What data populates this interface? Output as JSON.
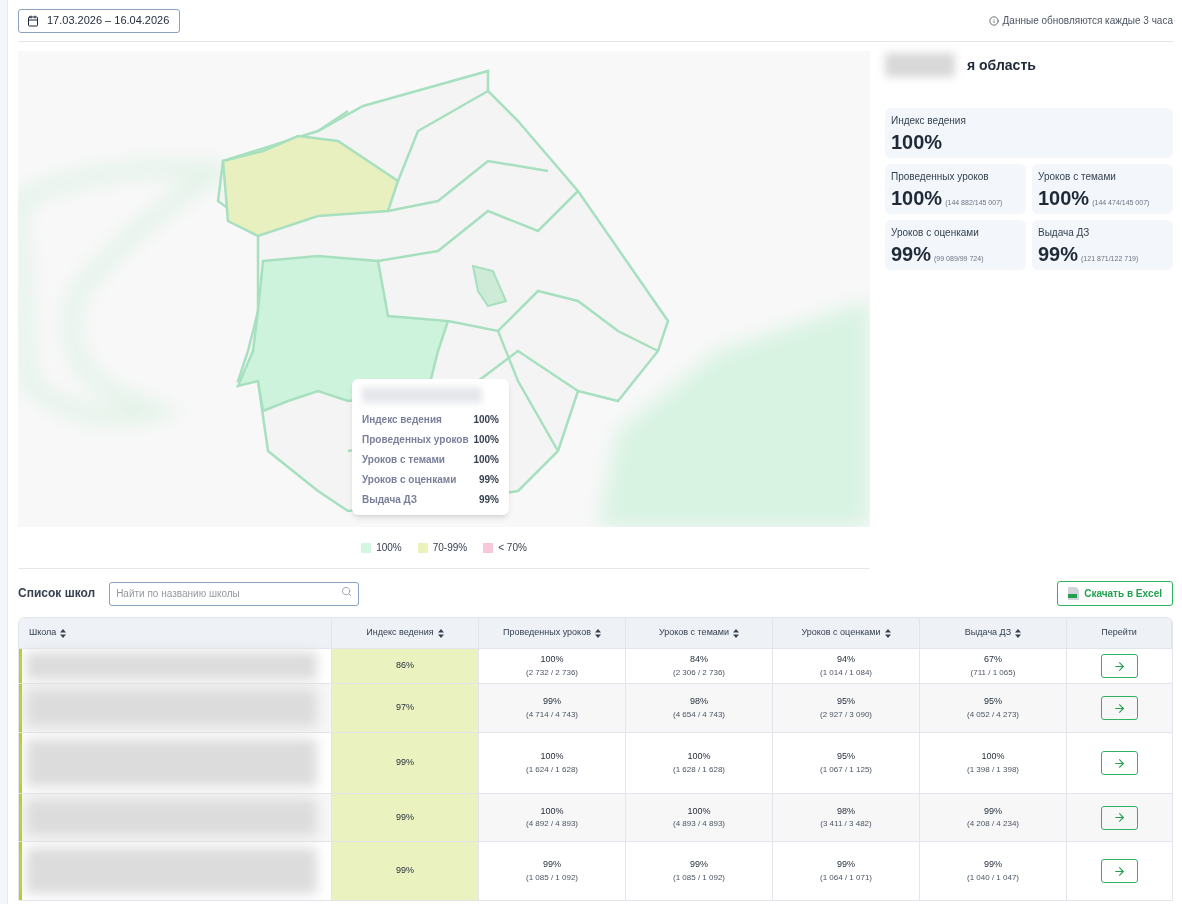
{
  "date_range": "17.03.2026 – 16.04.2026",
  "update_note": "Данные обновляются каждые 3 часа",
  "region": {
    "title": "я область",
    "metrics": [
      {
        "label": "Индекс ведения",
        "value": "100%"
      },
      {
        "label": "Проведенных уроков",
        "value": "100%",
        "detail": "(144 882/145 007)"
      },
      {
        "label": "Уроков с темами",
        "value": "100%",
        "detail": "(144 474/145 007)"
      },
      {
        "label": "Уроков с оценками",
        "value": "99%",
        "detail": "(99 089/99 724)"
      },
      {
        "label": "Выдача ДЗ",
        "value": "99%",
        "detail": "(121 871/122 719)"
      }
    ]
  },
  "map": {
    "tooltip": {
      "rows": [
        {
          "label": "Индекс ведения",
          "value": "100%"
        },
        {
          "label": "Проведенных уроков",
          "value": "100%"
        },
        {
          "label": "Уроков с темами",
          "value": "100%"
        },
        {
          "label": "Уроков с оценками",
          "value": "99%"
        },
        {
          "label": "Выдача ДЗ",
          "value": "99%"
        }
      ]
    },
    "legend": [
      {
        "label": "100%",
        "color": "#d5f5e3"
      },
      {
        "label": "70-99%",
        "color": "#ebf2bd"
      },
      {
        "label": "< 70%",
        "color": "#f8c8da"
      }
    ]
  },
  "schools": {
    "title": "Список школ",
    "search": {
      "placeholder": "Найти по названию школы"
    },
    "export_button": "Скачать в Excel",
    "columns": [
      "Школа",
      "Индекс ведения",
      "Проведенных уроков",
      "Уроков с темами",
      "Уроков с оценками",
      "Выдача ДЗ",
      "Перейти"
    ],
    "rows": [
      {
        "cells": [
          {
            "kind": "hidden"
          },
          {
            "value": "86%"
          },
          {
            "value": "100%",
            "detail": "(2 732 / 2 736)"
          },
          {
            "value": "84%",
            "detail": "(2 306 / 2 736)"
          },
          {
            "value": "94%",
            "detail": "(1 014 / 1 084)"
          },
          {
            "value": "67%",
            "detail": "(711 / 1 065)"
          }
        ]
      },
      {
        "cells": [
          {
            "kind": "hidden"
          },
          {
            "value": "97%"
          },
          {
            "value": "99%",
            "detail": "(4 714 / 4 743)"
          },
          {
            "value": "98%",
            "detail": "(4 654 / 4 743)"
          },
          {
            "value": "95%",
            "detail": "(2 927 / 3 090)"
          },
          {
            "value": "95%",
            "detail": "(4 052 / 4 273)"
          }
        ]
      },
      {
        "cells": [
          {
            "kind": "hidden"
          },
          {
            "value": "99%"
          },
          {
            "value": "100%",
            "detail": "(1 624 / 1 628)"
          },
          {
            "value": "100%",
            "detail": "(1 628 / 1 628)"
          },
          {
            "value": "95%",
            "detail": "(1 067 / 1 125)"
          },
          {
            "value": "100%",
            "detail": "(1 398 / 1 398)"
          }
        ]
      },
      {
        "cells": [
          {
            "kind": "hidden"
          },
          {
            "value": "99%"
          },
          {
            "value": "100%",
            "detail": "(4 892 / 4 893)"
          },
          {
            "value": "100%",
            "detail": "(4 893 / 4 893)"
          },
          {
            "value": "98%",
            "detail": "(3 411 / 3 482)"
          },
          {
            "value": "99%",
            "detail": "(4 208 / 4 234)"
          }
        ]
      },
      {
        "cells": [
          {
            "kind": "hidden"
          },
          {
            "value": "99%"
          },
          {
            "value": "99%",
            "detail": "(1 085 / 1 092)"
          },
          {
            "value": "99%",
            "detail": "(1 085 / 1 092)"
          },
          {
            "value": "99%",
            "detail": "(1 064 / 1 071)"
          },
          {
            "value": "99%",
            "detail": "(1 040 / 1 047)"
          }
        ]
      }
    ]
  }
}
